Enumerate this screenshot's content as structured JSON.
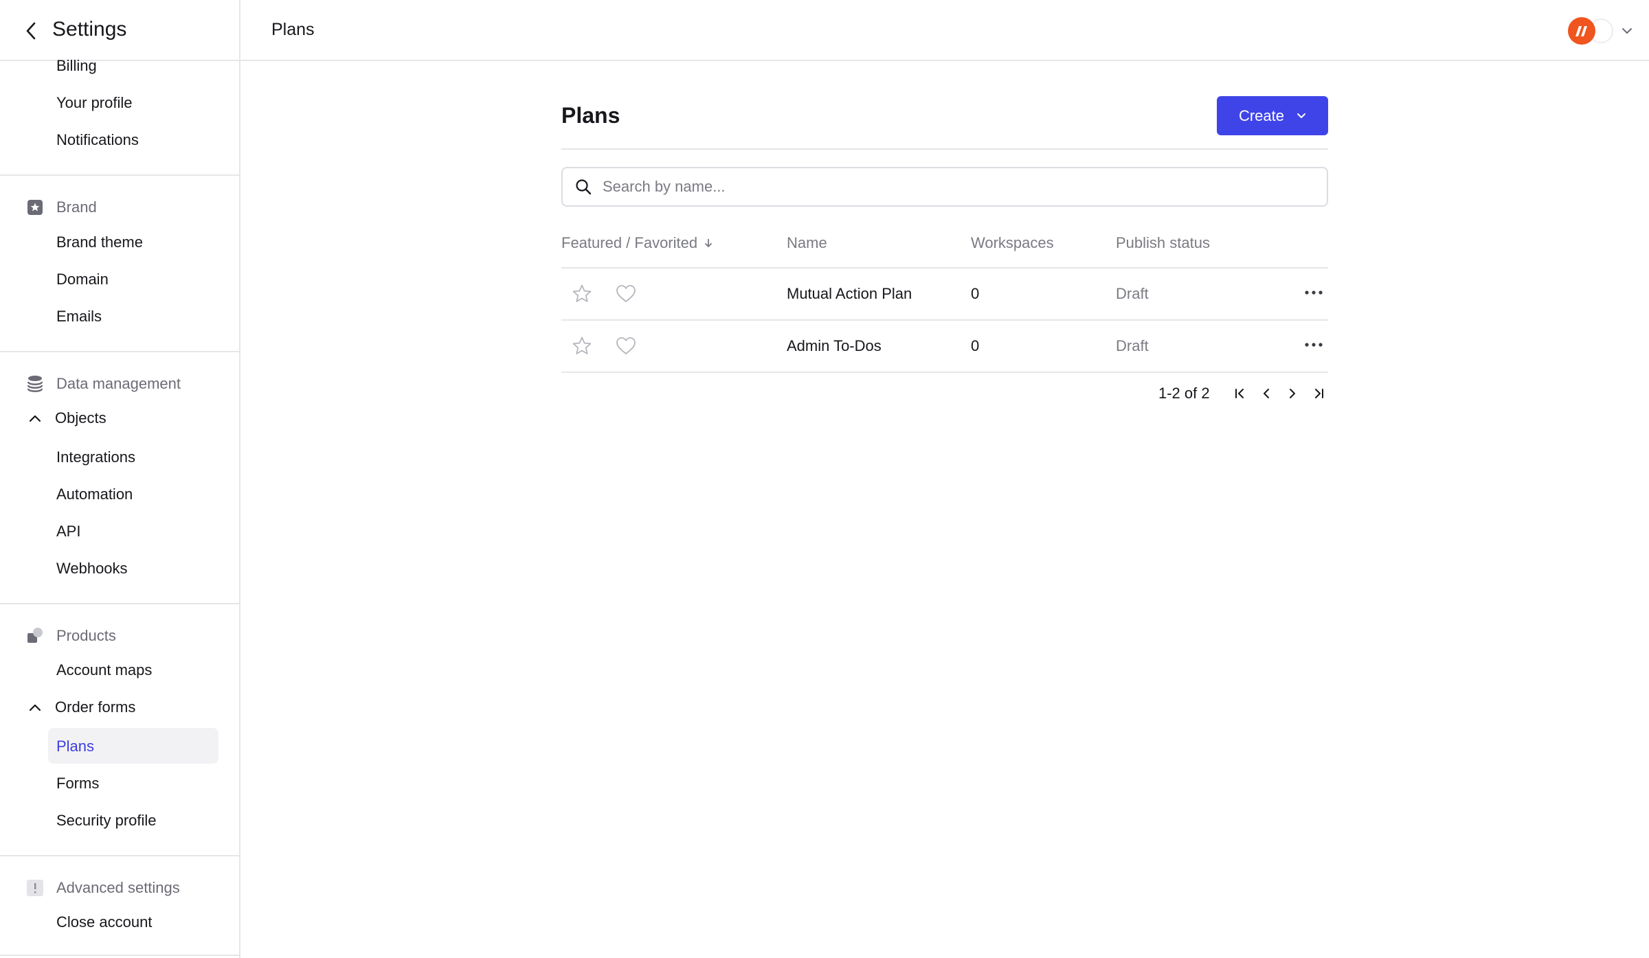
{
  "sidebar": {
    "title": "Settings",
    "items_top": [
      "Billing",
      "Your profile",
      "Notifications"
    ],
    "brand": {
      "label": "Brand",
      "items": [
        "Brand theme",
        "Domain",
        "Emails"
      ]
    },
    "data_management": {
      "label": "Data management",
      "objects_label": "Objects",
      "items": [
        "Integrations",
        "Automation",
        "API",
        "Webhooks"
      ]
    },
    "products": {
      "label": "Products",
      "account_maps": "Account maps",
      "order_forms_label": "Order forms",
      "items": [
        "Plans",
        "Forms",
        "Security profile"
      ]
    },
    "advanced": {
      "label": "Advanced settings",
      "items": [
        "Close account"
      ]
    }
  },
  "topbar": {
    "title": "Plans"
  },
  "main": {
    "title": "Plans",
    "create_label": "Create",
    "search_placeholder": "Search by name...",
    "columns": [
      "Featured / Favorited",
      "Name",
      "Workspaces",
      "Publish status"
    ],
    "rows": [
      {
        "name": "Mutual Action Plan",
        "workspaces": "0",
        "status": "Draft"
      },
      {
        "name": "Admin To-Dos",
        "workspaces": "0",
        "status": "Draft"
      }
    ],
    "pagination": "1-2 of 2"
  },
  "colors": {
    "accent": "#3f44e8",
    "brand_logo": "#f0541f",
    "muted": "#7a7a83"
  }
}
